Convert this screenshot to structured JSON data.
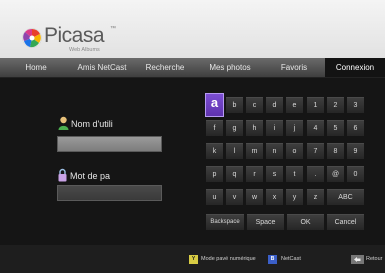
{
  "app": {
    "logo_text": "Picasa",
    "logo_tm": "™",
    "logo_subtitle": "Web Albums"
  },
  "nav": {
    "tabs": [
      {
        "label": "Home"
      },
      {
        "label": "Amis NetCast"
      },
      {
        "label": "Recherche"
      },
      {
        "label": "Mes photos"
      },
      {
        "label": "Favoris"
      },
      {
        "label": "Connexion",
        "active": true
      }
    ]
  },
  "form": {
    "username_label": "Nom d'utili",
    "username_value": "",
    "password_label": "Mot de pa",
    "password_value": ""
  },
  "keyboard": {
    "selected_key": "a",
    "keys_row1": [
      "a",
      "b",
      "c",
      "d",
      "e",
      "1",
      "2",
      "3"
    ],
    "keys_row2": [
      "f",
      "g",
      "h",
      "i",
      "j",
      "4",
      "5",
      "6"
    ],
    "keys_row3": [
      "k",
      "l",
      "m",
      "n",
      "o",
      "7",
      "8",
      "9"
    ],
    "keys_row4": [
      "p",
      "q",
      "r",
      "s",
      "t",
      ".",
      "@",
      "0"
    ],
    "keys_row5": [
      "u",
      "v",
      "w",
      "x",
      "y",
      "z",
      "ABC"
    ],
    "keys_row6": [
      "Backspace",
      "Space",
      "OK",
      "Cancel"
    ]
  },
  "footer": {
    "yellow_key": "Y",
    "yellow_label": "Mode pavé numérique",
    "blue_key": "B",
    "blue_label": "NetCast",
    "back_label": "Retour"
  },
  "colors": {
    "selected_key": "#6a3fc0",
    "username_field": "#8a8a8a",
    "yellow_button": "#d8cc44",
    "blue_button": "#3b5fc8"
  }
}
